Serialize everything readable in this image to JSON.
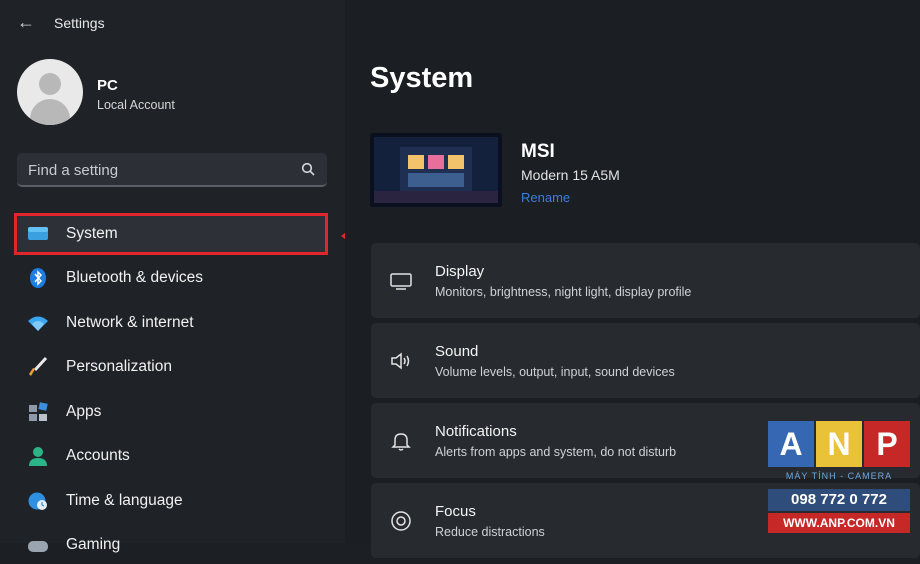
{
  "window": {
    "title": "Settings"
  },
  "user": {
    "name": "PC",
    "account_type": "Local Account"
  },
  "search": {
    "placeholder": "Find a setting"
  },
  "nav": [
    {
      "label": "System",
      "icon": "monitor-icon",
      "selected": true
    },
    {
      "label": "Bluetooth & devices",
      "icon": "bluetooth-icon"
    },
    {
      "label": "Network & internet",
      "icon": "wifi-icon"
    },
    {
      "label": "Personalization",
      "icon": "brush-icon"
    },
    {
      "label": "Apps",
      "icon": "apps-icon"
    },
    {
      "label": "Accounts",
      "icon": "person-icon"
    },
    {
      "label": "Time & language",
      "icon": "globe-clock-icon"
    },
    {
      "label": "Gaming",
      "icon": "gamepad-icon"
    }
  ],
  "main": {
    "title": "System",
    "device": {
      "name": "MSI",
      "model": "Modern 15 A5M",
      "rename_label": "Rename"
    },
    "cards": [
      {
        "title": "Display",
        "subtitle": "Monitors, brightness, night light, display profile",
        "icon": "display-icon"
      },
      {
        "title": "Sound",
        "subtitle": "Volume levels, output, input, sound devices",
        "icon": "speaker-icon"
      },
      {
        "title": "Notifications",
        "subtitle": "Alerts from apps and system, do not disturb",
        "icon": "bell-icon"
      },
      {
        "title": "Focus",
        "subtitle": "Reduce distractions",
        "icon": "focus-icon"
      }
    ]
  },
  "watermark": {
    "letters": [
      "A",
      "N",
      "P"
    ],
    "tagline": "MÁY TÍNH - CAMERA",
    "phone": "098 772 0 772",
    "website": "WWW.ANP.COM.VN"
  },
  "colors": {
    "highlight": "#e0262b",
    "accent": "#3b7de0",
    "background": "#1c1f24"
  }
}
